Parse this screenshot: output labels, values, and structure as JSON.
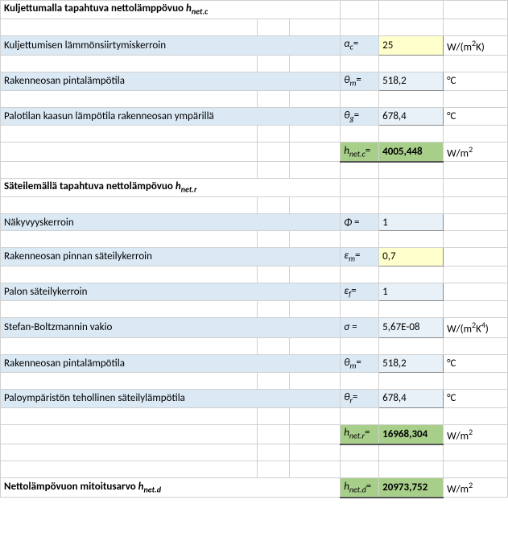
{
  "section1": {
    "title_a": "Kuljettumalla tapahtuva nettolämppövuo ",
    "title_sym": "h",
    "title_sub": "net.c",
    "rows": [
      {
        "label": "Kuljettumisen lämmönsiirtymiskerroin",
        "sym": "α",
        "sub": "c",
        "eq": "=",
        "val": "25",
        "unit_html": "W/(m<sup>2</sup>K)",
        "cls": "inp-yellow"
      },
      {
        "label": "Rakenneosan pintalämpötila",
        "sym": "θ",
        "sub": "m",
        "eq": "=",
        "val": "518,2",
        "unit_html": "°C",
        "cls": "inp-blue"
      },
      {
        "label": "Palotilan kaasun lämpötila rakenneosan ympärillä",
        "sym": "θ",
        "sub": "g",
        "eq": "=",
        "val": "678,4",
        "unit_html": "°C",
        "cls": "inp-blue"
      }
    ],
    "result": {
      "sym": "h",
      "sub": "net.c",
      "eq": "=",
      "val": "4005,448",
      "unit_html": "W/m<sup>2</sup>"
    }
  },
  "section2": {
    "title_a": "Säteilemällä tapahtuva nettolämpövuo ",
    "title_sym": "h",
    "title_sub": "net.r",
    "rows": [
      {
        "label": "Näkyvyyskerroin",
        "sym": "Φ",
        "sub": "",
        "eq": "=",
        "val": "1",
        "unit_html": "",
        "cls": "inp-blue"
      },
      {
        "label": "Rakenneosan pinnan säteilykerroin",
        "sym": "ε",
        "sub": "m",
        "eq": "=",
        "val": "0,7",
        "unit_html": "",
        "cls": "inp-yellow"
      },
      {
        "label": "Palon säteilykerroin",
        "sym": "ε",
        "sub": "f",
        "eq": "=",
        "val": "1",
        "unit_html": "",
        "cls": "inp-blue"
      },
      {
        "label": "Stefan-Boltzmannin vakio",
        "sym": "σ",
        "sub": "",
        "eq": "=",
        "val": "5,67E-08",
        "unit_html": "W/(m<sup>2</sup>K<sup>4</sup>)",
        "cls": "inp-blue"
      },
      {
        "label": "Rakenneosan pintalämpötila",
        "sym": "θ",
        "sub": "m",
        "eq": "=",
        "val": "518,2",
        "unit_html": "°C",
        "cls": "inp-blue"
      },
      {
        "label": "Paloympäristön tehollinen säteilylämpötila",
        "sym": "θ",
        "sub": "r",
        "eq": "=",
        "val": "678,4",
        "unit_html": "°C",
        "cls": "inp-blue"
      }
    ],
    "result": {
      "sym": "h",
      "sub": "net.r",
      "eq": "=",
      "val": "16968,304",
      "unit_html": "W/m<sup>2</sup>"
    }
  },
  "section3": {
    "title_a": "Nettolämpövuon mitoitusarvo ",
    "title_sym": "h",
    "title_sub": "net.d",
    "result": {
      "sym": "h",
      "sub": "net.d",
      "eq": "=",
      "val": "20973,752",
      "unit_html": "W/m<sup>2</sup>"
    }
  }
}
